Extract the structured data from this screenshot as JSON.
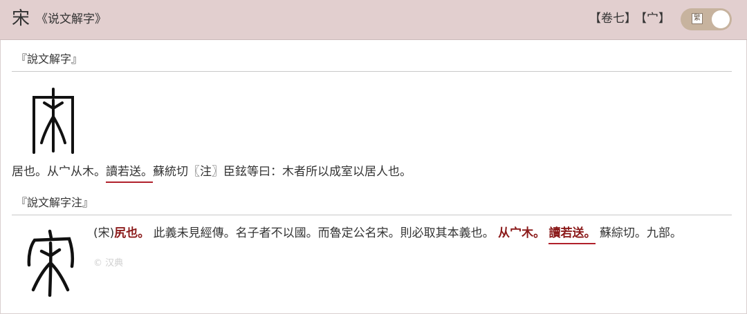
{
  "header": {
    "character": "宋",
    "book": "《说文解字》",
    "volume_tag": "【卷七】",
    "radical_tag": "【宀】",
    "toggle_glyph": "繁"
  },
  "shuowen": {
    "heading": "『說文解字』",
    "def_pre": "居也。从宀从木。",
    "def_reading": "讀若送。",
    "def_post": "蘇統切〖注〗臣鉉等曰：木者所以成室以居人也。"
  },
  "zhu": {
    "heading": "『說文解字注』",
    "p1": "(宋)",
    "p2": "尻也。",
    "p3": "此義未見經傳。名子者不以國。而魯定公名宋。則必取其本義也。",
    "p4": "从宀木。",
    "p5": "讀若送。",
    "p6": "蘇綜切。九部。",
    "copyright": "© 汉典"
  },
  "colors": {
    "header_bg": "#e2cfcf",
    "accent_red": "#8b1a1a",
    "underline": "#b0202a",
    "toggle_bg": "#c7b39e"
  }
}
